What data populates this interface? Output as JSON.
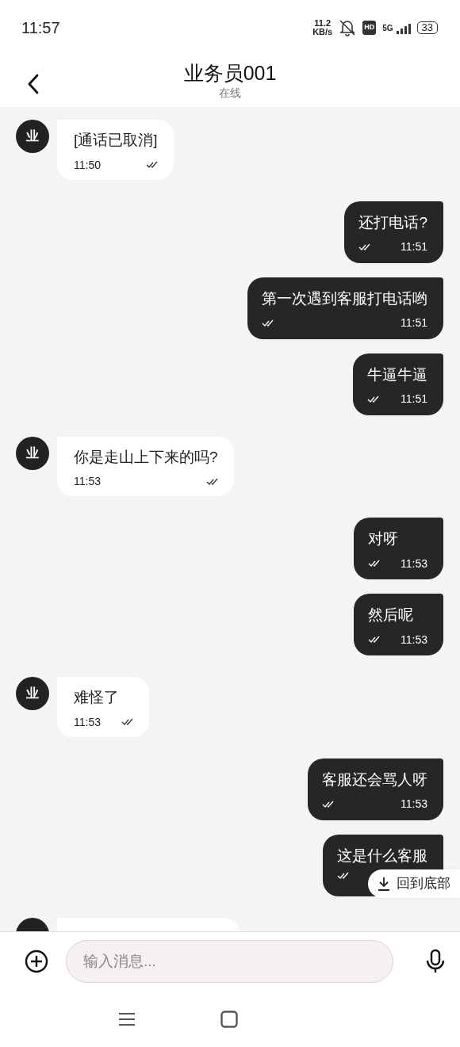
{
  "status_bar": {
    "time": "11:57",
    "speed_value": "11.2",
    "speed_unit": "KB/s",
    "hd": "HD",
    "network": "5G",
    "battery": "33"
  },
  "header": {
    "title": "业务员001",
    "subtitle": "在线"
  },
  "messages": [
    {
      "kind": "incoming",
      "avatar_text": "业",
      "text": "[通话已取消]",
      "time": "11:50"
    },
    {
      "kind": "outgoing",
      "text": "还打电话?",
      "time": "11:51"
    },
    {
      "kind": "outgoing",
      "text": "第一次遇到客服打电话哟",
      "time": "11:51"
    },
    {
      "kind": "outgoing",
      "text": "牛逼牛逼",
      "time": "11:51"
    },
    {
      "kind": "incoming",
      "avatar_text": "业",
      "text": "你是走山上下来的吗?",
      "time": "11:53"
    },
    {
      "kind": "outgoing",
      "text": "对呀",
      "time": "11:53"
    },
    {
      "kind": "outgoing",
      "text": "然后呢",
      "time": "11:53"
    },
    {
      "kind": "incoming",
      "avatar_text": "业",
      "text": "难怪了",
      "time": "11:53"
    },
    {
      "kind": "outgoing",
      "text": "客服还会骂人呀",
      "time": "11:53"
    },
    {
      "kind": "outgoing",
      "text": "这是什么客服"
    },
    {
      "kind": "incoming"
    }
  ],
  "jump_button": {
    "label": "回到底部"
  },
  "composer": {
    "placeholder": "输入消息..."
  }
}
